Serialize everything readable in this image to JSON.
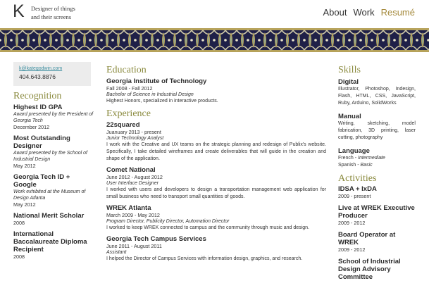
{
  "header": {
    "logo": "K",
    "tagline_line1": "Designer of things",
    "tagline_line2": "and their screens",
    "nav": [
      {
        "label": "About"
      },
      {
        "label": "Work"
      },
      {
        "label": "Resumé"
      }
    ]
  },
  "colors": {
    "band_background": "#1f2048",
    "band_gold": "#b6a25a",
    "band_green": "#8fa88f",
    "accent_gold": "#a58a3c",
    "section_title": "#8a8a3e",
    "link": "#3f8fa0"
  },
  "contact": {
    "email": "k@kategodwin.com",
    "phone": "404.643.8876"
  },
  "recognition": {
    "title": "Recognition",
    "items": [
      {
        "title": "Highest ID GPA",
        "sub": "Award presented by the President of Georgia Tech",
        "date": "December 2012"
      },
      {
        "title": "Most Outstanding Designer",
        "sub": "Award presented by the School of Industrial Design",
        "date": "May 2012"
      },
      {
        "title": "Georgia Tech ID + Google",
        "sub": "Work exhibited at the Museum of Design Atlanta",
        "date": "May 2012"
      },
      {
        "title": "National Merit Scholar",
        "sub": "",
        "date": "2008"
      },
      {
        "title": "International Baccalaureate Diploma Recipient",
        "sub": "",
        "date": "2008"
      }
    ]
  },
  "education": {
    "title": "Education",
    "school": "Georgia Institute of Technology",
    "dates": "Fall 2008 - Fall 2012",
    "degree": "Bachelor of Science in Industrial Design",
    "honors": "Highest Honors, specialized in interactive products."
  },
  "experience": {
    "title": "Experience",
    "items": [
      {
        "title": "22squared",
        "date": "Juanuary 2013 - present",
        "role": "Junior Technology Analyst",
        "desc": "I work with the Creative and UX teams on the strategic planning and redesign of Publix's website. Specifically, I take detailed wireframes and create deliverables that will guide in the creation and shape of the application."
      },
      {
        "title": "Comet National",
        "date": "June 2012 - August 2012",
        "role": "User Interface Designer",
        "desc": "I worked with users and developers to design a transportation management web application for small business who need to transport small quantities of goods."
      },
      {
        "title": "WREK Atlanta",
        "date": "March 2009 - May 2012",
        "role": "Program Director, Publicity Director, Automation Director",
        "desc": "I worked to keep WREK connected to campus and the community through music and design."
      },
      {
        "title": "Georgia Tech Campus Services",
        "date": "June 2011 - August 2011",
        "role": "Assistant",
        "desc": "I helped the Director of Campus Services with information design, graphics, and research."
      }
    ]
  },
  "skills": {
    "title": "Skills",
    "groups": [
      {
        "title": "Digital",
        "desc": "Illustrator, Photoshop, Indesign, Flash, HTML, CSS, JavaScript, Ruby, Arduino, SolidWorks"
      },
      {
        "title": "Manual",
        "desc": "Writing, sketching, model fabrication, 3D printing, laser cutting, photography"
      },
      {
        "title": "Language",
        "line1_plain": "French - ",
        "line1_italic": "Intermediate",
        "line2_plain": "Spanish - ",
        "line2_italic": "Basic"
      }
    ]
  },
  "activities": {
    "title": "Activities",
    "items": [
      {
        "title": "IDSA + IxDA",
        "date": "2009 - present"
      },
      {
        "title": "Live at WREK Executive Producer",
        "date": "2009 - 2012"
      },
      {
        "title": "Board Operator at WREK",
        "date": "2009 - 2012"
      },
      {
        "title": "School of Industrial Design Advisory Committee",
        "date": ""
      }
    ]
  }
}
